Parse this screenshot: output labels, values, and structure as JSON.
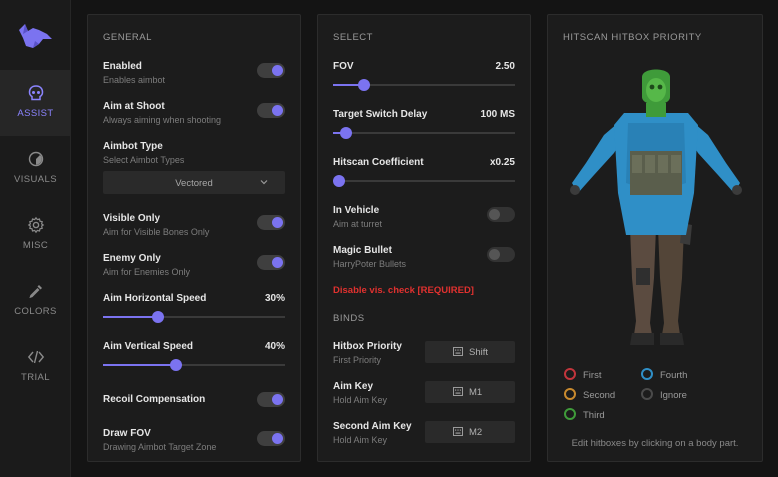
{
  "nav": {
    "items": [
      {
        "label": "ASSIST",
        "icon": "skull-icon",
        "active": true
      },
      {
        "label": "VISUALS",
        "icon": "eye-icon",
        "active": false
      },
      {
        "label": "MISC",
        "icon": "gear-icon",
        "active": false
      },
      {
        "label": "COLORS",
        "icon": "eyedropper-icon",
        "active": false
      },
      {
        "label": "TRIAL",
        "icon": "code-icon",
        "active": false
      }
    ]
  },
  "general": {
    "title": "GENERAL",
    "enabled": {
      "label": "Enabled",
      "sub": "Enables aimbot",
      "on": true
    },
    "aim_at_shoot": {
      "label": "Aim at Shoot",
      "sub": "Always aiming when shooting",
      "on": true
    },
    "aimbot_type": {
      "label": "Aimbot Type",
      "sub": "Select Aimbot Types",
      "value": "Vectored"
    },
    "visible_only": {
      "label": "Visible Only",
      "sub": "Aim for Visible Bones Only",
      "on": true
    },
    "enemy_only": {
      "label": "Enemy Only",
      "sub": "Aim for Enemies Only",
      "on": true
    },
    "h_speed": {
      "label": "Aim Horizontal Speed",
      "value": "30%",
      "fraction": 0.3
    },
    "v_speed": {
      "label": "Aim Vertical Speed",
      "value": "40%",
      "fraction": 0.4
    },
    "recoil": {
      "label": "Recoil Compensation",
      "on": true
    },
    "draw_fov": {
      "label": "Draw FOV",
      "sub": "Drawing Aimbot Target Zone",
      "on": true
    }
  },
  "select": {
    "title": "SELECT",
    "fov": {
      "label": "FOV",
      "value": "2.50",
      "fraction": 0.17
    },
    "switch_delay": {
      "label": "Target Switch Delay",
      "value": "100 MS",
      "fraction": 0.07
    },
    "hitscan": {
      "label": "Hitscan Coefficient",
      "value": "x0.25",
      "fraction": 0.0
    },
    "in_vehicle": {
      "label": "In Vehicle",
      "sub": "Aim at turret",
      "on": false
    },
    "magic_bullet": {
      "label": "Magic Bullet",
      "sub": "HarryPoter Bullets",
      "on": false
    },
    "warning": "Disable vis. check [REQUIRED]",
    "binds_title": "BINDS",
    "binds": [
      {
        "label": "Hitbox Priority",
        "sub": "First Priority",
        "key": "Shift"
      },
      {
        "label": "Aim Key",
        "sub": "Hold Aim Key",
        "key": "M1"
      },
      {
        "label": "Second Aim Key",
        "sub": "Hold Aim Key",
        "key": "M2"
      }
    ]
  },
  "hitbox": {
    "title": "HITSCAN HITBOX PRIORITY",
    "legend": [
      {
        "label": "First",
        "color": "#c2353c"
      },
      {
        "label": "Fourth",
        "color": "#2f8fc7"
      },
      {
        "label": "Second",
        "color": "#c98a2e"
      },
      {
        "label": "Ignore",
        "color": "#4a4a4a"
      },
      {
        "label": "Third",
        "color": "#3f9b3a"
      }
    ],
    "hint": "Edit hitboxes by clicking on a body part."
  },
  "colors": {
    "accent": "#7b73f0",
    "head_priority": "#3f9b3a",
    "torso_priority": "#2f8fc7"
  }
}
